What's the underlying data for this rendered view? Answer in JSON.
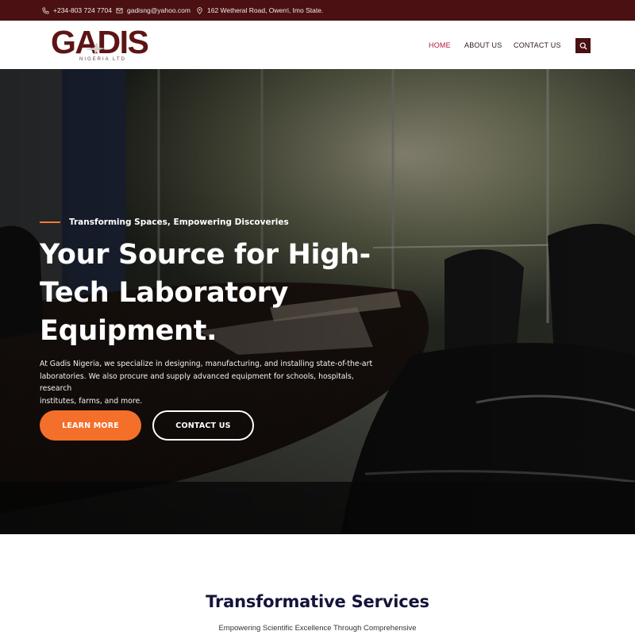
{
  "topbar": {
    "phone": "+234-803 724 7704",
    "email": "gadisng@yahoo.com",
    "address": "162 Wetheral Road, Owerri, Imo State.",
    "icons": {
      "phone": "phone-icon",
      "email": "envelope-icon",
      "address": "map-pin-icon"
    },
    "bg_color": "#4a1012"
  },
  "header": {
    "logo_text": "GADIS",
    "logo_sub": "NIGERIA LTD",
    "nav": {
      "home": "HOME",
      "about": "ABOUT US",
      "contact": "CONTACT US"
    },
    "active_color": "#b01a3a",
    "search_icon": "search-icon"
  },
  "hero": {
    "tagline": "Transforming Spaces, Empowering Discoveries",
    "headline_line1": "Your Source for High-",
    "headline_line2": "Tech Laboratory",
    "headline_line3": "Equipment.",
    "body_line1": "At Gadis Nigeria, we specialize in designing, manufacturing, and installing state-of-the-art",
    "body_line2": "laboratories. We also procure and supply advanced equipment for schools, hospitals, research",
    "body_line3": "institutes, farms, and more.",
    "learn_more": "LEARN MORE",
    "contact_us": "CONTACT US",
    "accent": "#f46f2a"
  },
  "services": {
    "title": "Transformative Services",
    "subtitle": "Empowering Scientific Excellence Through Comprehensive"
  }
}
